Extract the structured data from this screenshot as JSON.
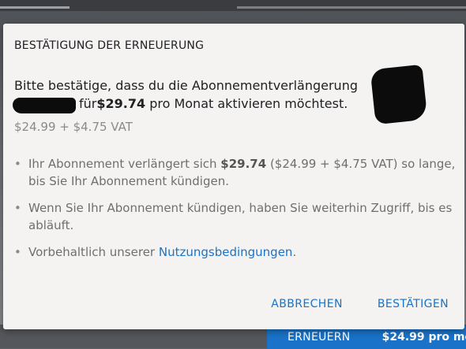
{
  "dialog": {
    "title": "BESTÄTIGUNG DER ERNEUERUNG",
    "message_line1": "Bitte bestätige, dass du die Abonnementverlängerung",
    "message_line2_prefix": "für",
    "message_line2_price": "$29.74",
    "message_line2_suffix": " pro Monat aktivieren möchtest.",
    "sub_price": "$24.99 + $4.75 VAT",
    "bullets": [
      {
        "pre": "Ihr Abonnement verlängert sich ",
        "bold": "$29.74",
        "post": " ($24.99 + $4.75 VAT) so lange, bis Sie Ihr Abonnement kündigen."
      },
      {
        "text": "Wenn Sie Ihr Abonnement kündigen, haben Sie weiterhin Zugriff, bis es abläuft."
      },
      {
        "pre": "Vorbehaltlich unserer ",
        "link": "Nutzungsbedingungen",
        "post": "."
      }
    ],
    "bullet_glyph": "•",
    "cancel_label": "ABBRECHEN",
    "confirm_label": "BESTÄTIGEN"
  },
  "background": {
    "renew_label": "ERNEUERN",
    "renew_price": "$24.99 pro mo"
  },
  "colors": {
    "accent": "#1a73c8",
    "dialog_bg": "#f4f3f1",
    "text_primary": "#202124",
    "text_secondary": "#6f6f6f"
  }
}
